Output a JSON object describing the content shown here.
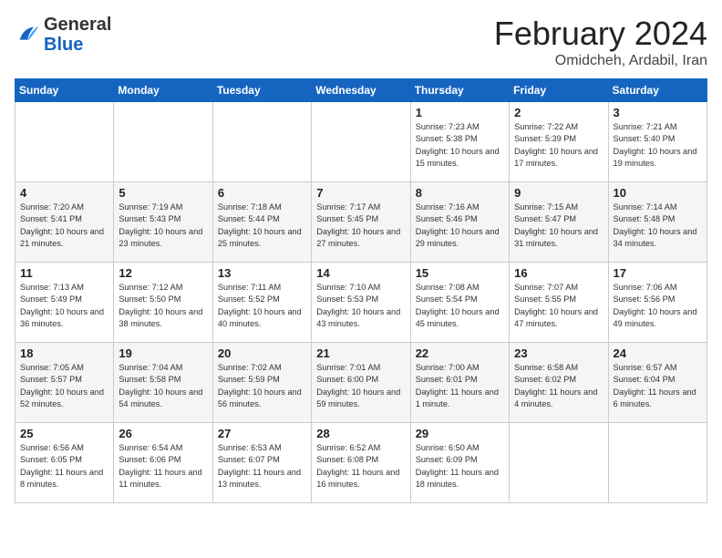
{
  "logo": {
    "general": "General",
    "blue": "Blue"
  },
  "title": "February 2024",
  "subtitle": "Omidcheh, Ardabil, Iran",
  "days_of_week": [
    "Sunday",
    "Monday",
    "Tuesday",
    "Wednesday",
    "Thursday",
    "Friday",
    "Saturday"
  ],
  "weeks": [
    [
      {
        "num": "",
        "detail": ""
      },
      {
        "num": "",
        "detail": ""
      },
      {
        "num": "",
        "detail": ""
      },
      {
        "num": "",
        "detail": ""
      },
      {
        "num": "1",
        "detail": "Sunrise: 7:23 AM\nSunset: 5:38 PM\nDaylight: 10 hours\nand 15 minutes."
      },
      {
        "num": "2",
        "detail": "Sunrise: 7:22 AM\nSunset: 5:39 PM\nDaylight: 10 hours\nand 17 minutes."
      },
      {
        "num": "3",
        "detail": "Sunrise: 7:21 AM\nSunset: 5:40 PM\nDaylight: 10 hours\nand 19 minutes."
      }
    ],
    [
      {
        "num": "4",
        "detail": "Sunrise: 7:20 AM\nSunset: 5:41 PM\nDaylight: 10 hours\nand 21 minutes."
      },
      {
        "num": "5",
        "detail": "Sunrise: 7:19 AM\nSunset: 5:43 PM\nDaylight: 10 hours\nand 23 minutes."
      },
      {
        "num": "6",
        "detail": "Sunrise: 7:18 AM\nSunset: 5:44 PM\nDaylight: 10 hours\nand 25 minutes."
      },
      {
        "num": "7",
        "detail": "Sunrise: 7:17 AM\nSunset: 5:45 PM\nDaylight: 10 hours\nand 27 minutes."
      },
      {
        "num": "8",
        "detail": "Sunrise: 7:16 AM\nSunset: 5:46 PM\nDaylight: 10 hours\nand 29 minutes."
      },
      {
        "num": "9",
        "detail": "Sunrise: 7:15 AM\nSunset: 5:47 PM\nDaylight: 10 hours\nand 31 minutes."
      },
      {
        "num": "10",
        "detail": "Sunrise: 7:14 AM\nSunset: 5:48 PM\nDaylight: 10 hours\nand 34 minutes."
      }
    ],
    [
      {
        "num": "11",
        "detail": "Sunrise: 7:13 AM\nSunset: 5:49 PM\nDaylight: 10 hours\nand 36 minutes."
      },
      {
        "num": "12",
        "detail": "Sunrise: 7:12 AM\nSunset: 5:50 PM\nDaylight: 10 hours\nand 38 minutes."
      },
      {
        "num": "13",
        "detail": "Sunrise: 7:11 AM\nSunset: 5:52 PM\nDaylight: 10 hours\nand 40 minutes."
      },
      {
        "num": "14",
        "detail": "Sunrise: 7:10 AM\nSunset: 5:53 PM\nDaylight: 10 hours\nand 43 minutes."
      },
      {
        "num": "15",
        "detail": "Sunrise: 7:08 AM\nSunset: 5:54 PM\nDaylight: 10 hours\nand 45 minutes."
      },
      {
        "num": "16",
        "detail": "Sunrise: 7:07 AM\nSunset: 5:55 PM\nDaylight: 10 hours\nand 47 minutes."
      },
      {
        "num": "17",
        "detail": "Sunrise: 7:06 AM\nSunset: 5:56 PM\nDaylight: 10 hours\nand 49 minutes."
      }
    ],
    [
      {
        "num": "18",
        "detail": "Sunrise: 7:05 AM\nSunset: 5:57 PM\nDaylight: 10 hours\nand 52 minutes."
      },
      {
        "num": "19",
        "detail": "Sunrise: 7:04 AM\nSunset: 5:58 PM\nDaylight: 10 hours\nand 54 minutes."
      },
      {
        "num": "20",
        "detail": "Sunrise: 7:02 AM\nSunset: 5:59 PM\nDaylight: 10 hours\nand 56 minutes."
      },
      {
        "num": "21",
        "detail": "Sunrise: 7:01 AM\nSunset: 6:00 PM\nDaylight: 10 hours\nand 59 minutes."
      },
      {
        "num": "22",
        "detail": "Sunrise: 7:00 AM\nSunset: 6:01 PM\nDaylight: 11 hours\nand 1 minute."
      },
      {
        "num": "23",
        "detail": "Sunrise: 6:58 AM\nSunset: 6:02 PM\nDaylight: 11 hours\nand 4 minutes."
      },
      {
        "num": "24",
        "detail": "Sunrise: 6:57 AM\nSunset: 6:04 PM\nDaylight: 11 hours\nand 6 minutes."
      }
    ],
    [
      {
        "num": "25",
        "detail": "Sunrise: 6:56 AM\nSunset: 6:05 PM\nDaylight: 11 hours\nand 8 minutes."
      },
      {
        "num": "26",
        "detail": "Sunrise: 6:54 AM\nSunset: 6:06 PM\nDaylight: 11 hours\nand 11 minutes."
      },
      {
        "num": "27",
        "detail": "Sunrise: 6:53 AM\nSunset: 6:07 PM\nDaylight: 11 hours\nand 13 minutes."
      },
      {
        "num": "28",
        "detail": "Sunrise: 6:52 AM\nSunset: 6:08 PM\nDaylight: 11 hours\nand 16 minutes."
      },
      {
        "num": "29",
        "detail": "Sunrise: 6:50 AM\nSunset: 6:09 PM\nDaylight: 11 hours\nand 18 minutes."
      },
      {
        "num": "",
        "detail": ""
      },
      {
        "num": "",
        "detail": ""
      }
    ]
  ]
}
